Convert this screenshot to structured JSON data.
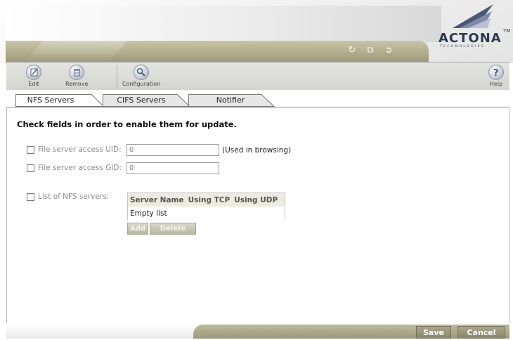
{
  "brand": {
    "name": "ACTONA",
    "tm": "TM",
    "subtitle": "TECHNOLOGIES"
  },
  "header_icons": [
    "refresh-icon",
    "window-icon",
    "logout-icon"
  ],
  "toolbar": {
    "edit": "Edit",
    "remove": "Remove",
    "configuration": "Configuration",
    "help": "Help"
  },
  "tabs": [
    {
      "label": "NFS Servers",
      "active": true
    },
    {
      "label": "CIFS Servers",
      "active": false
    },
    {
      "label": "Notifier",
      "active": false
    }
  ],
  "form": {
    "instructions": "Check fields in order to enable them for update.",
    "uid": {
      "label": "File server access UID:",
      "value": "0",
      "hint": "(Used in browsing)"
    },
    "gid": {
      "label": "File server access GID:",
      "value": "0"
    },
    "nfs_list": {
      "label": "List of NFS servers:",
      "columns": [
        "Server Name",
        "Using TCP",
        "Using UDP"
      ],
      "empty_text": "Empty list",
      "add_label": "Add",
      "delete_label": "Delete"
    }
  },
  "footer": {
    "save": "Save",
    "cancel": "Cancel"
  },
  "colors": {
    "header_bar": "#b0ad8c",
    "footer_button": "#8a8668",
    "table_header": "#ebebdf"
  }
}
